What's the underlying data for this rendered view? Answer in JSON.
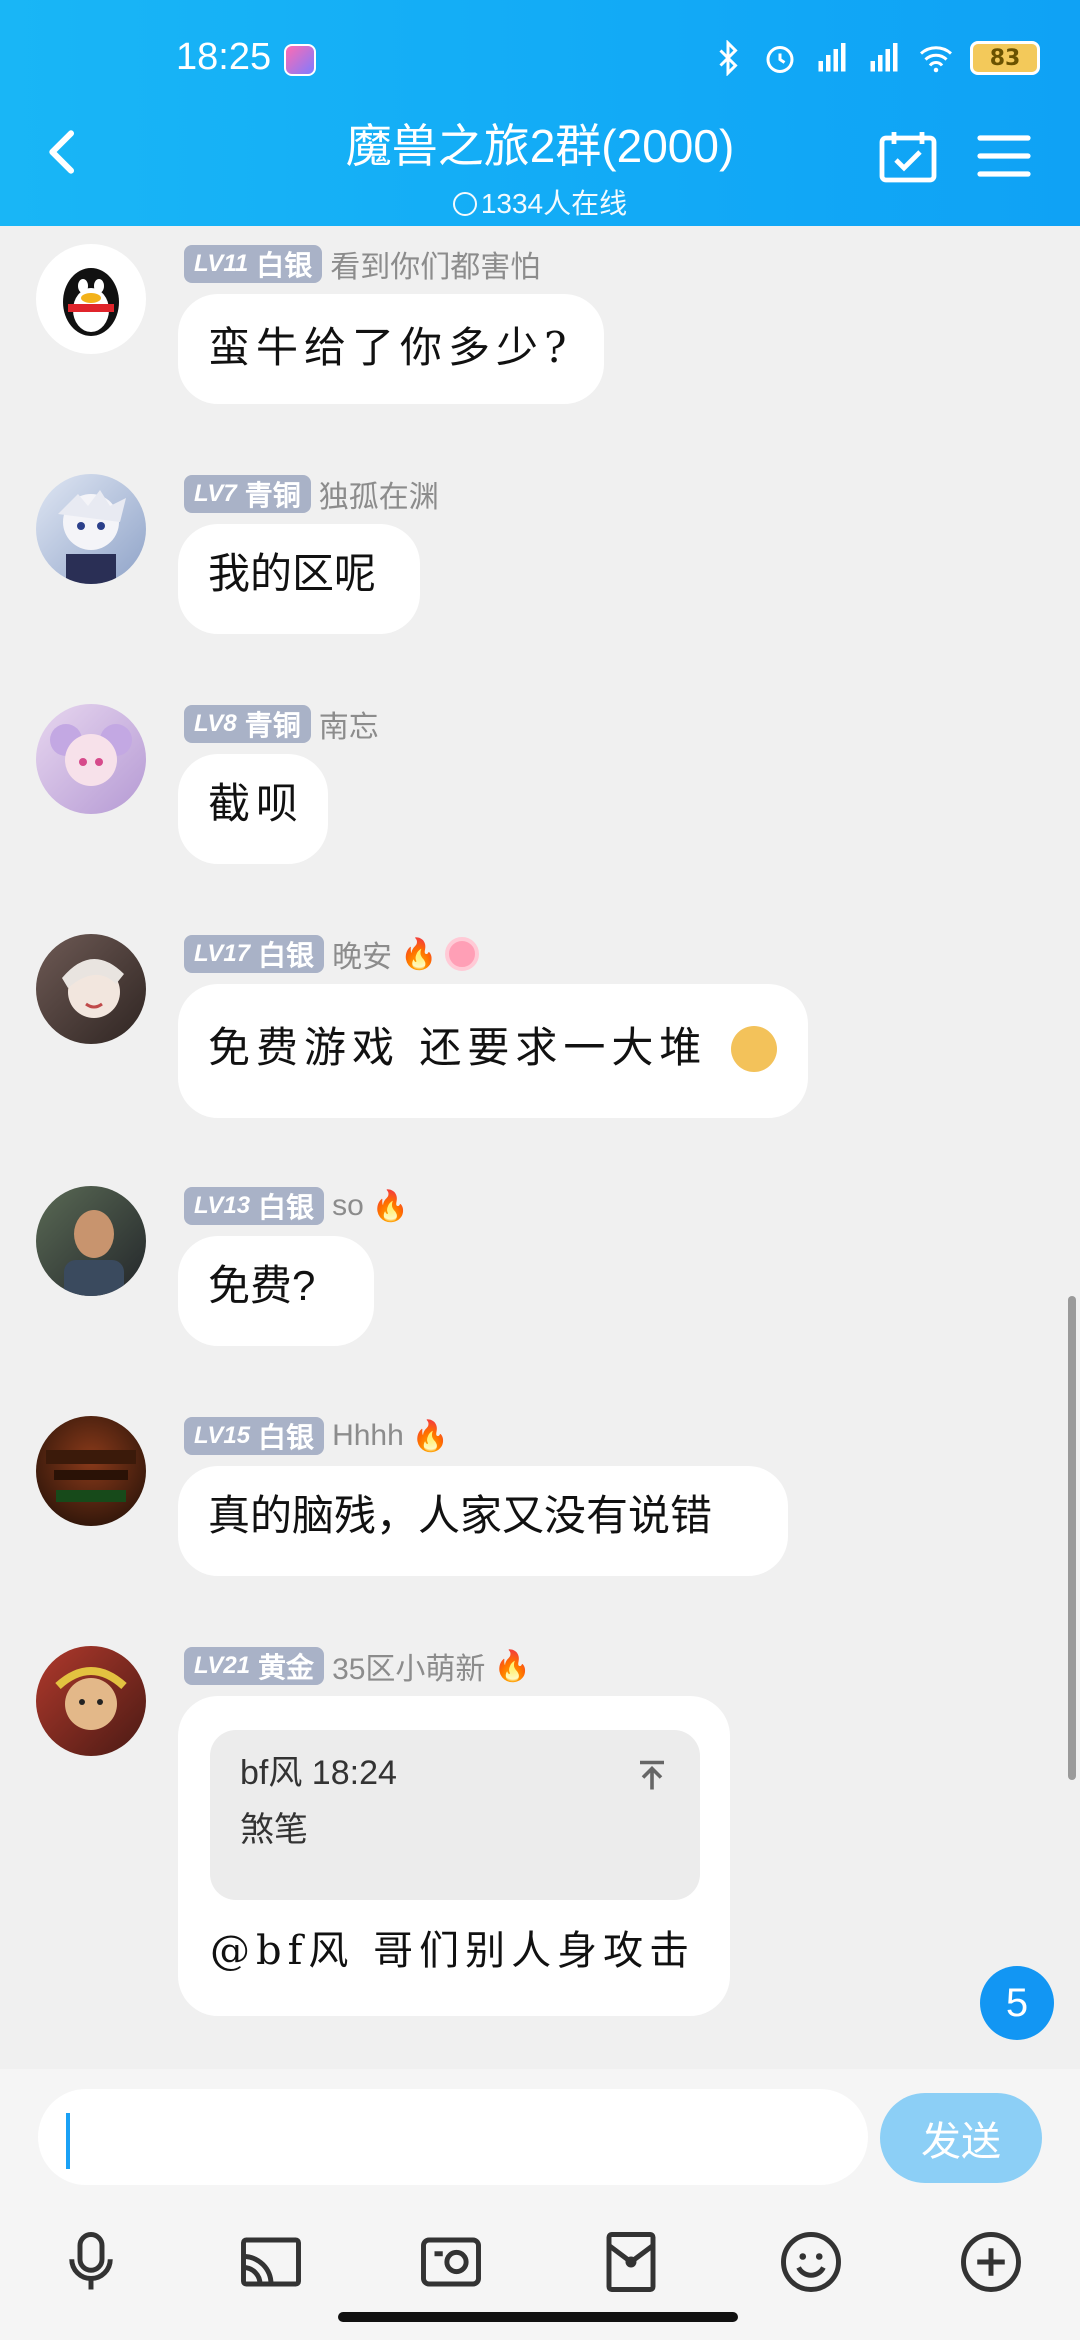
{
  "status": {
    "time": "18:25",
    "battery": "83"
  },
  "header": {
    "title": "魔兽之旅2群(2000)",
    "online": "1334人在线"
  },
  "colors": {
    "header_bg": "#12aaf6",
    "level_tag": "#a9b2c7",
    "send_button": "#8ccff6",
    "unread_badge": "#1296f3"
  },
  "messages": [
    {
      "level": "LV11",
      "rank": "白银",
      "nick": "看到你们都害怕",
      "text": "蛮牛给了你多少?"
    },
    {
      "level": "LV7",
      "rank": "青铜",
      "nick": "独孤在渊",
      "text": "我的区呢"
    },
    {
      "level": "LV8",
      "rank": "青铜",
      "nick": "南忘",
      "text": "截呗"
    },
    {
      "level": "LV17",
      "rank": "白银",
      "nick": "晚安",
      "text": "免费游戏 还要求一大堆"
    },
    {
      "level": "LV13",
      "rank": "白银",
      "nick": "so",
      "text": "免费?"
    },
    {
      "level": "LV15",
      "rank": "白银",
      "nick": "Hhhh",
      "text": "真的脑残，人家又没有说错"
    },
    {
      "level": "LV21",
      "rank": "黄金",
      "nick": "35区小萌新",
      "quote_head": "bf风 18:24",
      "quote_text": "煞笔",
      "text": "@bf风  哥们别人身攻击"
    }
  ],
  "unread_count": "5",
  "input": {
    "value": "",
    "send_label": "发送"
  }
}
